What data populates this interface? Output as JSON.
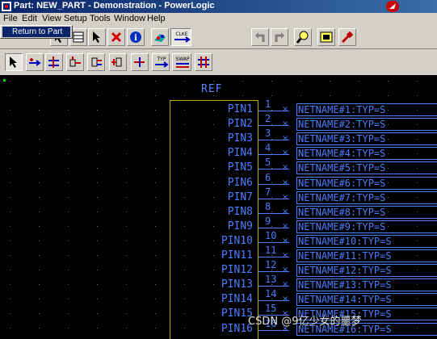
{
  "window": {
    "title": "Part: NEW_PART - Demonstration - PowerLogic"
  },
  "menu": {
    "items": [
      {
        "label": "File",
        "key": "F"
      },
      {
        "label": "Edit",
        "key": "E"
      },
      {
        "label": "View",
        "key": "V"
      },
      {
        "label": "Setup",
        "key": "S"
      },
      {
        "label": "Tools",
        "key": "T"
      },
      {
        "label": "Window",
        "key": "W"
      },
      {
        "label": "Help",
        "key": "H"
      }
    ]
  },
  "file_menu": {
    "items": [
      {
        "label": "Return to Part"
      }
    ]
  },
  "toolbar1": {
    "icons": [
      "select-arrow-icon",
      "view-icon",
      "delete-icon",
      "info-icon",
      "properties-icon",
      "clke-icon",
      "undo-icon",
      "redo-icon",
      "zoom-icon",
      "window-icon",
      "tool-icon"
    ],
    "clke_label": "CLKE"
  },
  "toolbar2": {
    "icons": [
      "select-icon",
      "add-terminal-icon",
      "add-terminals-icon",
      "pin-icon",
      "pin-box-icon",
      "pin-rotate-icon",
      "pin-arrow-icon",
      "type-icon",
      "swap-icon",
      "pin-bus-icon"
    ],
    "type_label": "TYP",
    "swap_label": "SWAP"
  },
  "canvas": {
    "ref_label": "REF",
    "pins": [
      {
        "name": "PIN1",
        "num": "1",
        "net": "NETNAME#1:TYP=S"
      },
      {
        "name": "PIN2",
        "num": "2",
        "net": "NETNAME#2:TYP=S"
      },
      {
        "name": "PIN3",
        "num": "3",
        "net": "NETNAME#3:TYP=S"
      },
      {
        "name": "PIN4",
        "num": "4",
        "net": "NETNAME#4:TYP=S"
      },
      {
        "name": "PIN5",
        "num": "5",
        "net": "NETNAME#5:TYP=S"
      },
      {
        "name": "PIN6",
        "num": "6",
        "net": "NETNAME#6:TYP=S"
      },
      {
        "name": "PIN7",
        "num": "7",
        "net": "NETNAME#7:TYP=S"
      },
      {
        "name": "PIN8",
        "num": "8",
        "net": "NETNAME#8:TYP=S"
      },
      {
        "name": "PIN9",
        "num": "9",
        "net": "NETNAME#9:TYP=S"
      },
      {
        "name": "PIN10",
        "num": "10",
        "net": "NETNAME#10:TYP=S"
      },
      {
        "name": "PIN11",
        "num": "11",
        "net": "NETNAME#11:TYP=S"
      },
      {
        "name": "PIN12",
        "num": "12",
        "net": "NETNAME#12:TYP=S"
      },
      {
        "name": "PIN13",
        "num": "13",
        "net": "NETNAME#13:TYP=S"
      },
      {
        "name": "PIN14",
        "num": "14",
        "net": "NETNAME#14:TYP=S"
      },
      {
        "name": "PIN15",
        "num": "15",
        "net": "NETNAME#15:TYP=S"
      },
      {
        "name": "PIN16",
        "num": "16",
        "net": "NETNAME#16:TYP=S"
      }
    ]
  },
  "watermark": "CSDN @9亿少女的噩梦"
}
